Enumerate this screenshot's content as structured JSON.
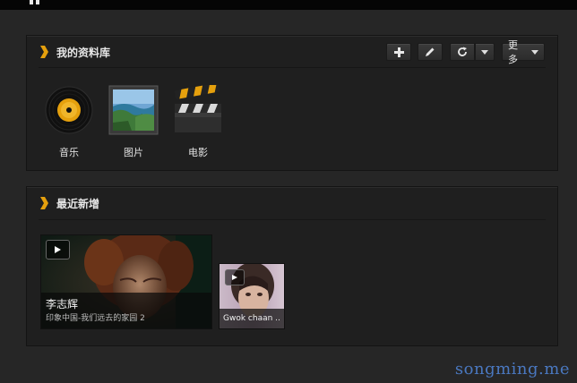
{
  "header": {
    "logo_icon": "plex-logo-icon"
  },
  "library": {
    "title": "我的资料库",
    "toolbar": {
      "add_icon": "plus-icon",
      "edit_icon": "pencil-icon",
      "refresh_icon": "refresh-icon",
      "refresh_menu_icon": "chevron-down-icon",
      "more_label": "更多"
    },
    "items": [
      {
        "label": "音乐",
        "icon": "music-disc-icon"
      },
      {
        "label": "图片",
        "icon": "photo-icon"
      },
      {
        "label": "电影",
        "icon": "clapperboard-icon"
      }
    ]
  },
  "recent": {
    "title": "最近新增",
    "items": [
      {
        "title": "李志辉",
        "subtitle": "印象中国-我们远去的家园 2"
      },
      {
        "title": "Gwok chaan ..."
      }
    ]
  },
  "watermark": "songming.me",
  "colors": {
    "accent": "#e5a00d",
    "background": "#262626",
    "panel": "#1f1f1f",
    "watermark": "#4a78c0"
  }
}
